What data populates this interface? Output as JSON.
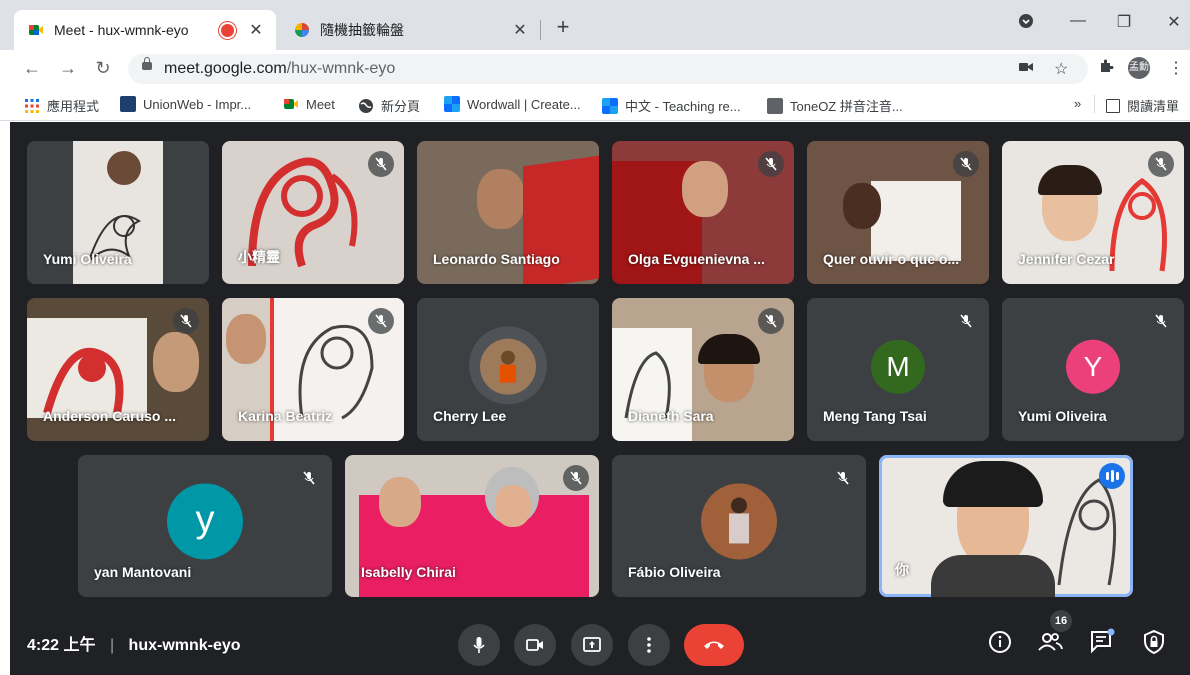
{
  "browser": {
    "tabs": [
      {
        "title": "Meet - hux-wmnk-eyo",
        "recording": true,
        "active": true
      },
      {
        "title": "隨機抽籤輪盤",
        "active": false
      }
    ],
    "url_domain": "meet.google.com",
    "url_path": "/hux-wmnk-eyo",
    "profile_label": "孟勳",
    "bookmarks": [
      {
        "label": "應用程式",
        "icon": "apps-grid-icon"
      },
      {
        "label": "UnionWeb - Impr...",
        "icon": "unionweb-icon"
      },
      {
        "label": "Meet",
        "icon": "meet-icon"
      },
      {
        "label": "新分頁",
        "icon": "globe-icon"
      },
      {
        "label": "Wordwall | Create...",
        "icon": "wordwall-icon"
      },
      {
        "label": "中文 - Teaching re...",
        "icon": "wordwall-icon"
      },
      {
        "label": "ToneOZ 拼音注音...",
        "icon": "toneoz-icon"
      }
    ],
    "overflow": "»",
    "reading_list": "閱讀清單"
  },
  "meet": {
    "participants": [
      {
        "name": "Yumi Oliveira",
        "muted": false,
        "type": "video"
      },
      {
        "name": "小精靈",
        "muted": true,
        "type": "video"
      },
      {
        "name": "Leonardo Santiago",
        "muted": false,
        "type": "video"
      },
      {
        "name": "Olga Evguenievna ...",
        "muted": true,
        "type": "video"
      },
      {
        "name": "Quer ouvir o que o...",
        "muted": true,
        "type": "video"
      },
      {
        "name": "Jennifer Cezar",
        "muted": true,
        "type": "video"
      },
      {
        "name": "Anderson Caruso ...",
        "muted": true,
        "type": "video"
      },
      {
        "name": "Karina Beatriz",
        "muted": true,
        "type": "video"
      },
      {
        "name": "Cherry Lee",
        "muted": false,
        "type": "photo"
      },
      {
        "name": "Dianeth Sara",
        "muted": true,
        "type": "video"
      },
      {
        "name": "Meng Tang Tsai",
        "muted": true,
        "type": "avatar",
        "initial": "M",
        "color": "#33691e"
      },
      {
        "name": "Yumi Oliveira",
        "muted": true,
        "type": "avatar",
        "initial": "Y",
        "color": "#ec407a"
      },
      {
        "name": "yan Mantovani",
        "muted": true,
        "type": "avatar",
        "initial": "y",
        "color": "#0097a7"
      },
      {
        "name": "Isabelly Chirai",
        "muted": true,
        "type": "video"
      },
      {
        "name": "Fábio Oliveira",
        "muted": true,
        "type": "photo"
      },
      {
        "name": "你",
        "muted": false,
        "type": "self",
        "speaking": true
      }
    ],
    "time": "4:22 上午",
    "meeting_code": "hux-wmnk-eyo",
    "participant_count": "16",
    "colors": {
      "background": "#202124",
      "tile": "#3c4043",
      "end_call": "#ea4335",
      "accent": "#1a73e8"
    }
  }
}
